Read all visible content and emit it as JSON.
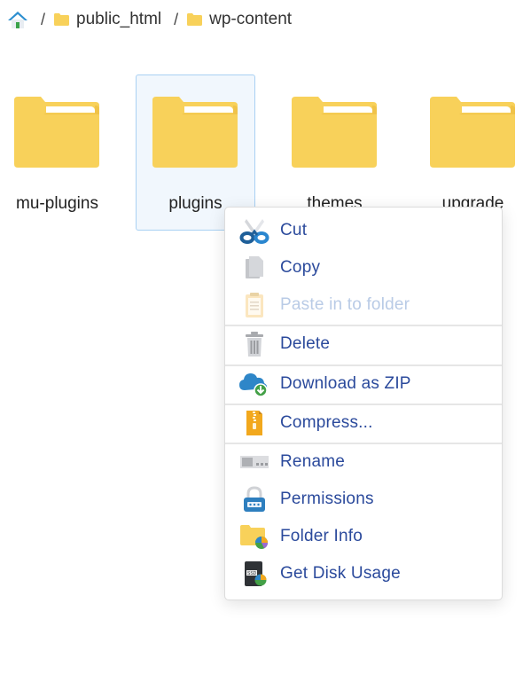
{
  "breadcrumb": {
    "home_icon": "home-icon",
    "separator": "/",
    "items": [
      {
        "label": "public_html",
        "icon": "folder-icon"
      },
      {
        "label": "wp-content",
        "icon": "folder-icon"
      }
    ]
  },
  "folders": [
    {
      "name": "mu-plugins",
      "selected": false
    },
    {
      "name": "plugins",
      "selected": true
    },
    {
      "name": "themes",
      "selected": false
    },
    {
      "name": "upgrade",
      "selected": false
    }
  ],
  "context_menu": {
    "items": [
      {
        "label": "Cut",
        "icon": "scissors-icon",
        "enabled": true
      },
      {
        "label": "Copy",
        "icon": "copy-icon",
        "enabled": true
      },
      {
        "label": "Paste in to folder",
        "icon": "clipboard-icon",
        "enabled": false
      },
      {
        "label": "Delete",
        "icon": "trash-icon",
        "enabled": true
      },
      {
        "label": "Download as ZIP",
        "icon": "cloud-download-icon",
        "enabled": true
      },
      {
        "label": "Compress...",
        "icon": "zip-archive-icon",
        "enabled": true
      },
      {
        "label": "Rename",
        "icon": "rename-icon",
        "enabled": true
      },
      {
        "label": "Permissions",
        "icon": "lock-icon",
        "enabled": true
      },
      {
        "label": "Folder Info",
        "icon": "folder-info-icon",
        "enabled": true
      },
      {
        "label": "Get Disk Usage",
        "icon": "disk-usage-icon",
        "enabled": true
      }
    ]
  },
  "colors": {
    "menu_text": "#2b4a9c",
    "menu_text_disabled": "#b9cbe6",
    "folder": "#f8d15a",
    "selection_bg": "#f1f7fd",
    "selection_border": "#a9d1f3"
  }
}
